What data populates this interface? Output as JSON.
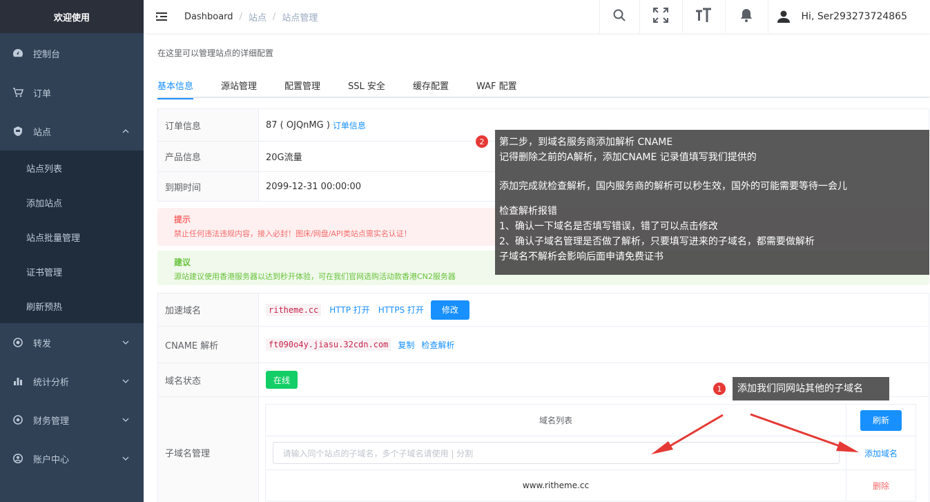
{
  "sidebar": {
    "brand": "欢迎使用",
    "items": [
      {
        "label": "控制台"
      },
      {
        "label": "订单"
      },
      {
        "label": "站点"
      },
      {
        "label": "转发"
      },
      {
        "label": "统计分析"
      },
      {
        "label": "财务管理"
      },
      {
        "label": "账户中心"
      }
    ],
    "sub_items": [
      "站点列表",
      "添加站点",
      "站点批量管理",
      "证书管理",
      "刷新预热"
    ]
  },
  "header": {
    "breadcrumb": [
      "Dashboard",
      "站点",
      "站点管理"
    ],
    "user": "Hi, Ser293273724865"
  },
  "main": {
    "description": "在这里可以管理站点的详细配置",
    "tabs": [
      "基本信息",
      "源站管理",
      "配置管理",
      "SSL 安全",
      "缓存配置",
      "WAF 配置"
    ],
    "info": {
      "order_label": "订单信息",
      "order_value": "87 ( OJQnMG )",
      "order_link": "订单信息",
      "product_label": "产品信息",
      "product_value": "20G流量",
      "expire_label": "到期时间",
      "expire_value": "2099-12-31 00:00:00"
    },
    "alert_warn": {
      "title": "提示",
      "text": "禁止任何违法违规内容，接入必封！图床/网盘/API类站点需实名认证！"
    },
    "alert_tip": {
      "title": "建议",
      "text": "源站建议使用香港服务器以达到秒开体验，可在我们官网选购活动款香港CN2服务器"
    },
    "domain": {
      "label": "加速域名",
      "value": "ritheme.cc",
      "http_link": "HTTP 打开",
      "https_link": "HTTPS 打开",
      "edit_button": "修改"
    },
    "cname": {
      "label": "CNAME 解析",
      "value": "ft090o4y.jiasu.32cdn.com",
      "copy_link": "复制",
      "check_link": "检查解析"
    },
    "status": {
      "label": "域名状态",
      "value": "在线"
    },
    "subdomain": {
      "label": "子域名管理",
      "list_header": "域名列表",
      "refresh_button": "刷新",
      "input_placeholder": "请输入同个站点的子域名，多个子域名请使用 | 分割",
      "add_link": "添加域名",
      "rows": [
        {
          "domain": "www.ritheme.cc",
          "action": "删除"
        }
      ]
    }
  },
  "annotations": {
    "step2": {
      "badge": "2",
      "line1": "第二步，到域名服务商添加解析 CNAME",
      "line2": "记得删除之前的A解析，添加CNAME 记录值填写我们提供的",
      "line3": "添加完成就检查解析，国内服务商的解析可以秒生效，国外的可能需要等待一会儿",
      "line4": "检查解析报错",
      "line5": "1、确认一下域名是否填写错误，错了可以点击修改",
      "line6": "2、确认子域名管理是否做了解析，只要填写进来的子域名，都需要做解析",
      "line7": "子域名不解析会影响后面申请免费证书"
    },
    "step1": {
      "badge": "1",
      "text": "添加我们同网站其他的子域名"
    }
  },
  "colors": {
    "sidebar_bg": "#304156",
    "accent": "#1890ff",
    "success": "#13ce66",
    "danger": "#f56c6c"
  }
}
